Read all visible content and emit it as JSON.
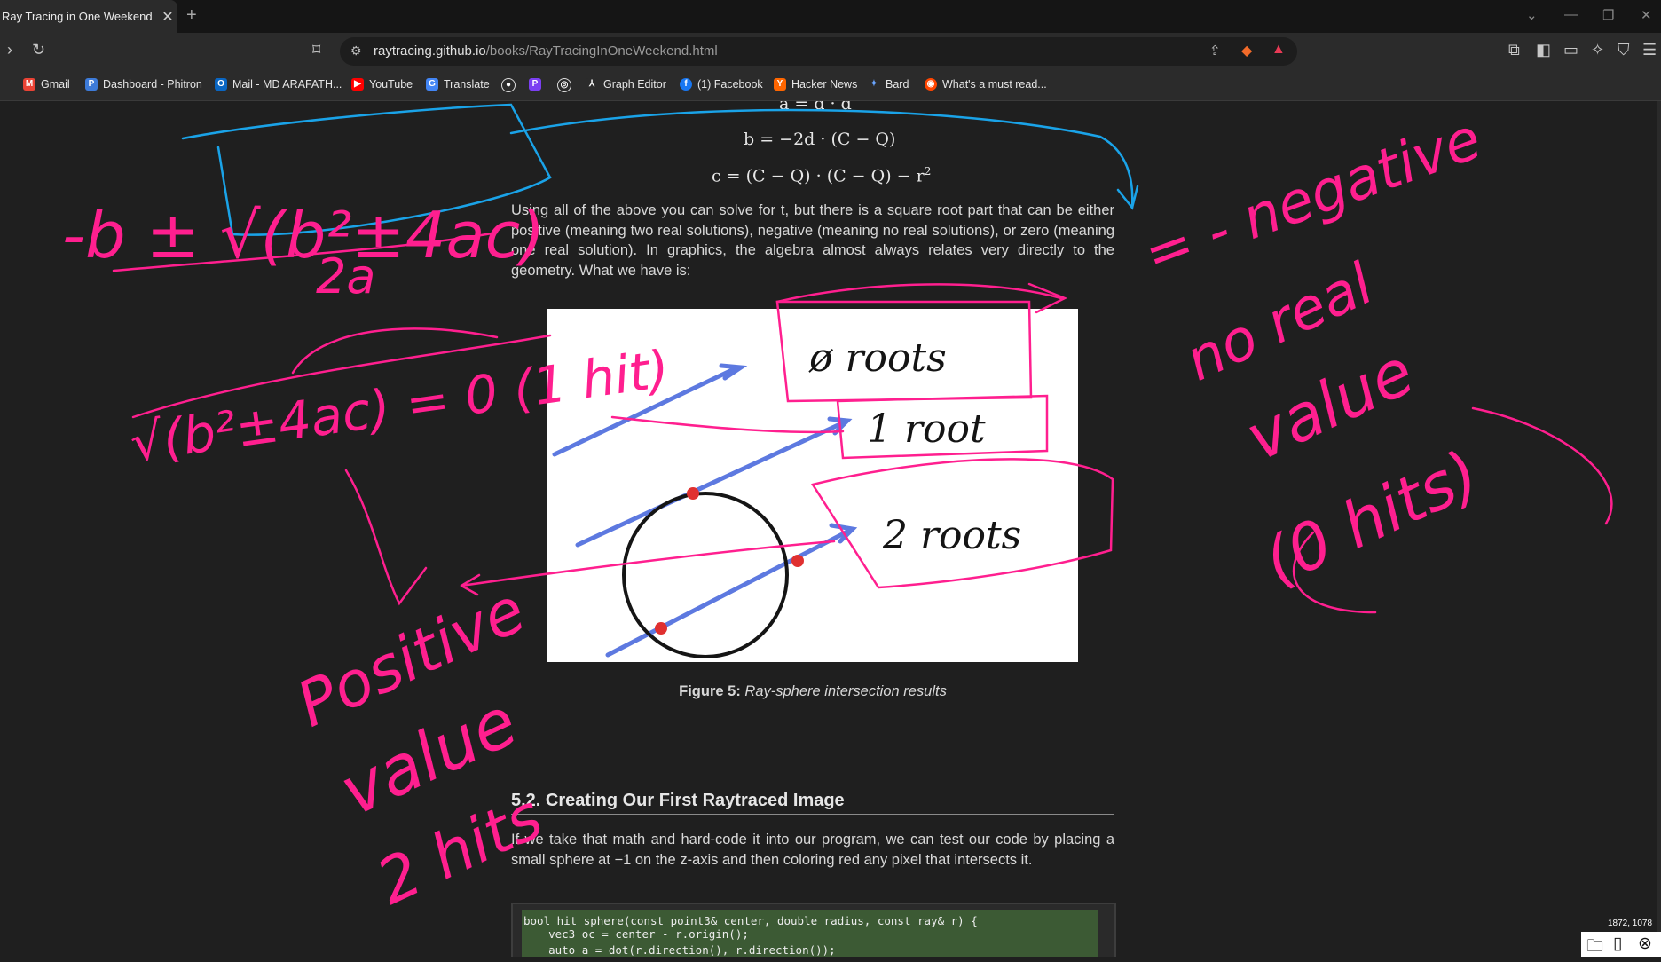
{
  "browser": {
    "tab_title": "Ray Tracing in One Weekend",
    "tab_close": "✕",
    "new_tab": "+",
    "url_host": "raytracing.github.io",
    "url_path": "/books/RayTracingInOneWeekend.html",
    "bookmarks": [
      {
        "label": "Gmail"
      },
      {
        "label": "Dashboard - Phitron"
      },
      {
        "label": "Mail - MD ARAFATH..."
      },
      {
        "label": "YouTube"
      },
      {
        "label": "Translate"
      },
      {
        "label": "Graph Editor"
      },
      {
        "label": "(1) Facebook"
      },
      {
        "label": "Hacker News"
      },
      {
        "label": "Bard"
      },
      {
        "label": "What's a must read..."
      }
    ]
  },
  "article": {
    "eq_a": "a = d · d",
    "eq_b": "b = −2d · (C − Q)",
    "eq_c_main": "c = (C − Q) · (C − Q) − r",
    "eq_c_sup": "2",
    "para1": "Using all of the above you can solve for t, but there is a square root part that can be either positive (meaning two real solutions), negative (meaning no real solutions), or zero (meaning one real solution). In graphics, the algebra almost always relates very directly to the geometry. What we have is:",
    "figure_caption_label": "Figure 5:",
    "figure_caption_text": "Ray-sphere intersection results",
    "figure_labels": [
      "ø roots",
      "1 root",
      "2 roots"
    ],
    "section_heading": "5.2.  Creating Our First Raytraced Image",
    "para2": "If we take that math and hard-code it into our program, we can test our code by placing a small sphere at −1 on the z-axis and then coloring red any pixel that intersects it.",
    "code_lines": [
      "bool hit_sphere(const point3& center, double radius, const ray& r) {",
      "    vec3 oc = center - r.origin();",
      "    auto a = dot(r.direction(), r.direction());"
    ]
  },
  "annotations": {
    "formula_top": "-b ± √(b²±4ac)",
    "formula_denominator": "2a",
    "formula_left": "√(b²±4ac) = 0 (1 hit)",
    "negative": "= - negative",
    "no_real": "no real",
    "value_right": "value",
    "zero_hits": "(0 hits)",
    "positive": "Positive",
    "value_left": "value",
    "two_hits": "2 hits"
  },
  "status": {
    "coords": "1872, 1078"
  },
  "colors": {
    "ink_pink": "#ff1f8f",
    "ink_blue": "#1aa3e8"
  }
}
